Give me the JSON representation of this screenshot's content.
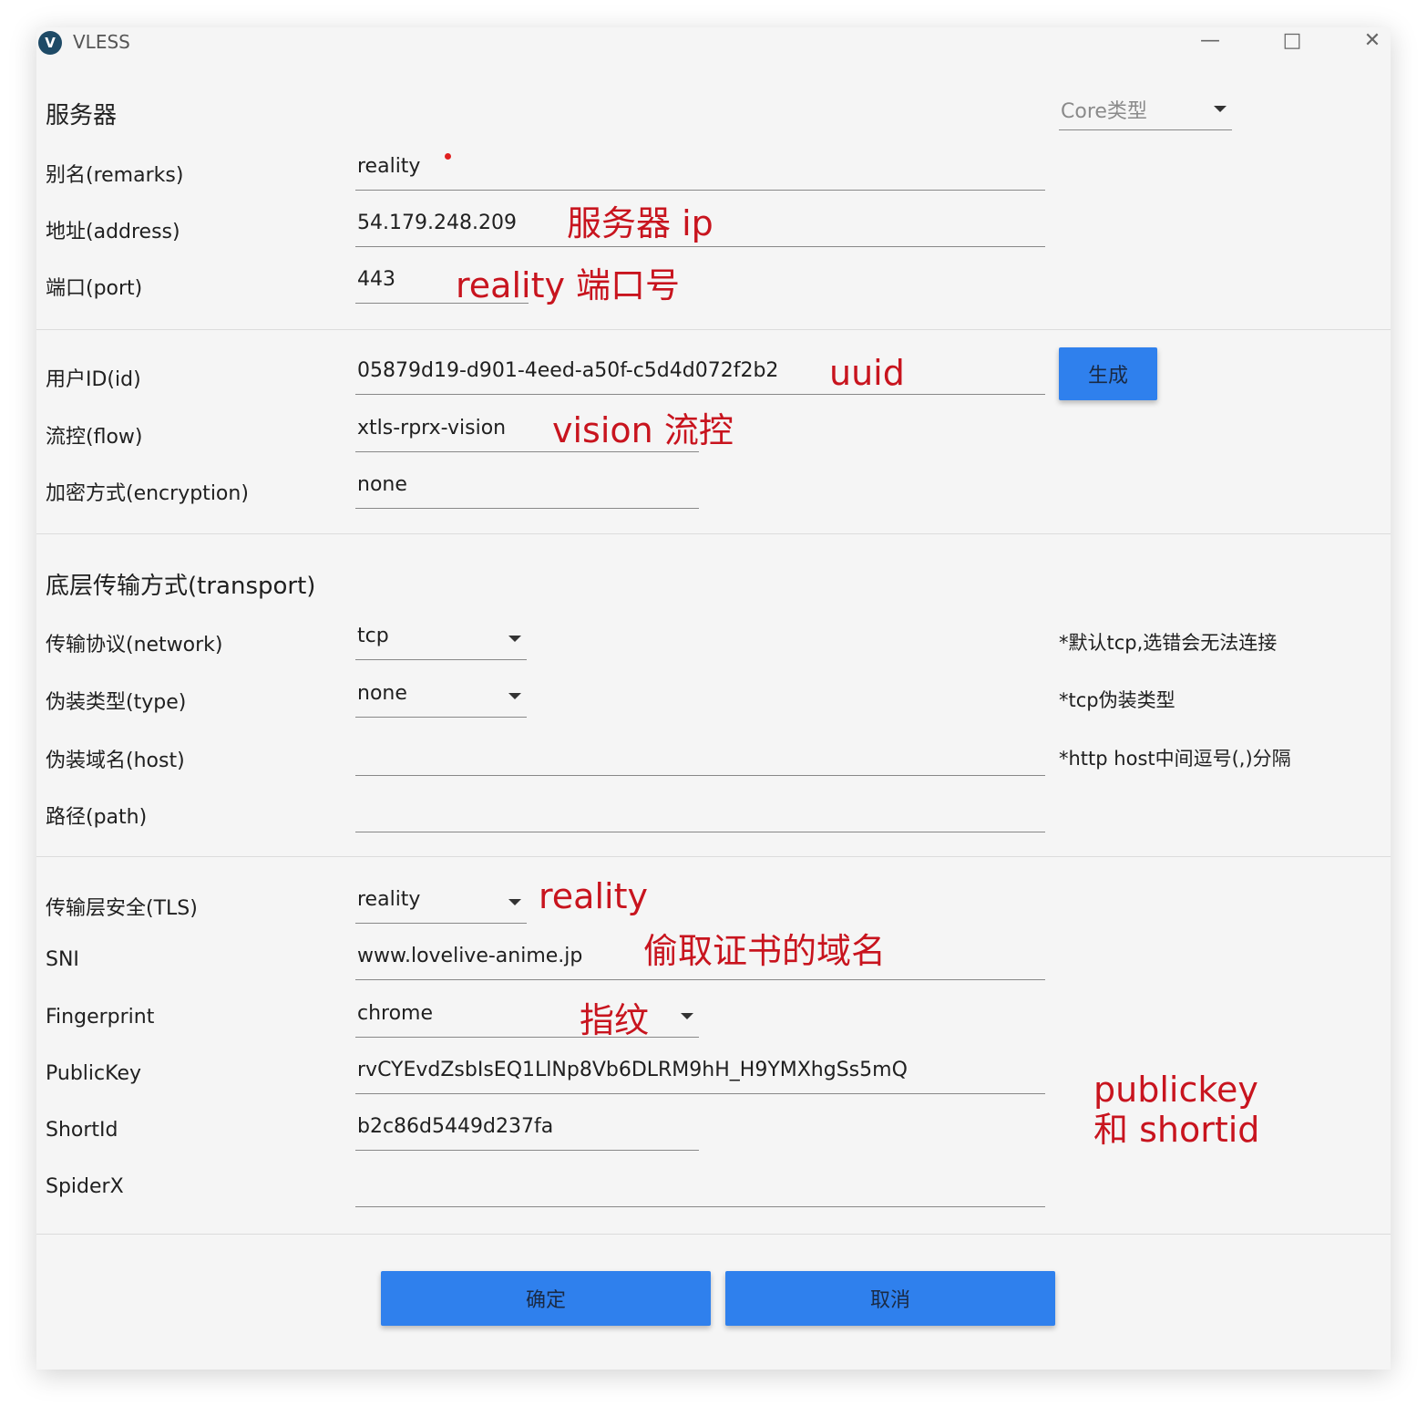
{
  "window": {
    "title": "VLESS",
    "icon": "v2rayn-app-icon",
    "controls": [
      "minimize-icon",
      "maximize-icon",
      "close-icon"
    ]
  },
  "core_type": {
    "placeholder": "Core类型"
  },
  "server": {
    "heading": "服务器",
    "remarks": {
      "label": "别名(remarks)",
      "value": "reality"
    },
    "address": {
      "label": "地址(address)",
      "value": "54.179.248.209"
    },
    "port": {
      "label": "端口(port)",
      "value": "443"
    }
  },
  "user": {
    "id": {
      "label": "用户ID(id)",
      "value": "05879d19-d901-4eed-a50f-c5d4d072f2b2",
      "generate_label": "生成"
    },
    "flow": {
      "label": "流控(flow)",
      "value": "xtls-rprx-vision"
    },
    "encryption": {
      "label": "加密方式(encryption)",
      "value": "none"
    }
  },
  "transport": {
    "heading": "底层传输方式(transport)",
    "network": {
      "label": "传输协议(network)",
      "value": "tcp",
      "hint": "*默认tcp,选错会无法连接"
    },
    "type": {
      "label": "伪装类型(type)",
      "value": "none",
      "hint": "*tcp伪装类型"
    },
    "host": {
      "label": "伪装域名(host)",
      "value": "",
      "hint": "*http host中间逗号(,)分隔"
    },
    "path": {
      "label": "路径(path)",
      "value": ""
    }
  },
  "tls": {
    "security": {
      "label": "传输层安全(TLS)",
      "value": "reality"
    },
    "sni": {
      "label": "SNI",
      "value": "www.lovelive-anime.jp"
    },
    "fingerprint": {
      "label": "Fingerprint",
      "value": "chrome"
    },
    "publickey": {
      "label": "PublicKey",
      "value": "rvCYEvdZsbIsEQ1LlNp8Vb6DLRM9hH_H9YMXhgSs5mQ"
    },
    "shortid": {
      "label": "ShortId",
      "value": "b2c86d5449d237fa"
    },
    "spiderx": {
      "label": "SpiderX",
      "value": ""
    }
  },
  "buttons": {
    "ok": "确定",
    "cancel": "取消"
  },
  "annotations": {
    "server_ip": "服务器 ip",
    "port": "reality 端口号",
    "uuid": "uuid",
    "flow": "vision 流控",
    "security": "reality",
    "sni": "偷取证书的域名",
    "fingerprint": "指纹",
    "keys_line1": "publickey",
    "keys_line2": "和 shortid",
    "color": "#c8141e"
  },
  "colors": {
    "accent": "#2f80ed",
    "background": "#f5f5f5",
    "required_dot": "#e02020"
  }
}
